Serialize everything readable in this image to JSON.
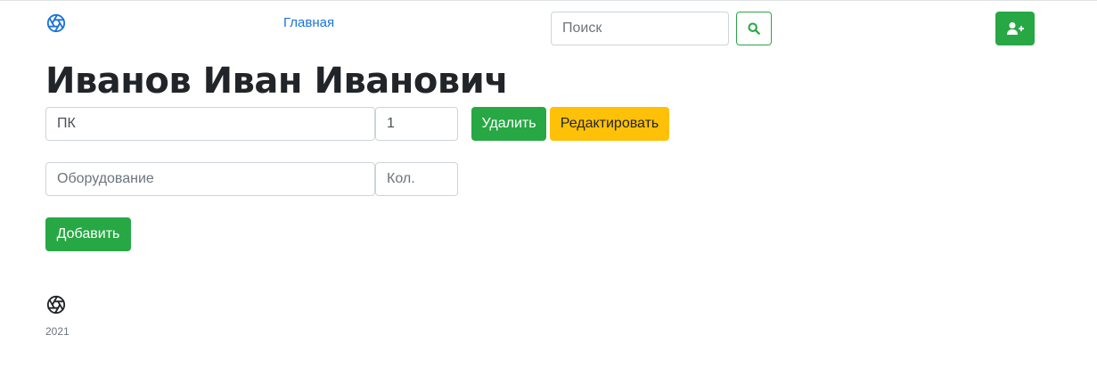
{
  "header": {
    "logo_icon": "aperture-icon",
    "nav_home": "Главная",
    "search_placeholder": "Поиск",
    "search_icon": "search-icon",
    "add_user_icon": "user-plus-icon"
  },
  "page": {
    "title": "Иванов Иван Иванович"
  },
  "equipment_item": {
    "name": "ПК",
    "quantity": "1",
    "delete_label": "Удалить",
    "edit_label": "Редактировать"
  },
  "new_equipment": {
    "name_placeholder": "Оборудование",
    "quantity_placeholder": "Кол.",
    "add_label": "Добавить"
  },
  "footer": {
    "logo_icon": "aperture-icon",
    "year": "2021"
  },
  "colors": {
    "accent_green": "#28a745",
    "accent_yellow": "#ffc107",
    "link_blue": "#1a73d9"
  }
}
